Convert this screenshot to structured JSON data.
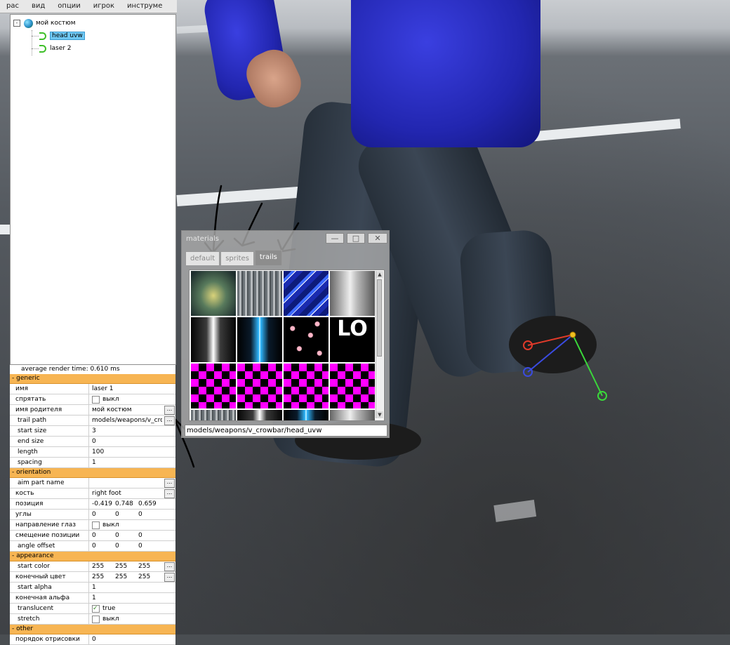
{
  "menu": [
    "рас",
    "вид",
    "опции",
    "игрок",
    "инструме"
  ],
  "tree": {
    "root": "мой костюм",
    "expander": "-",
    "children": [
      "head uvw",
      "laser 2"
    ]
  },
  "render_time": "average render time: 0.610 ms",
  "properties": {
    "generic": {
      "header": "-  generic",
      "name_key": "имя",
      "name_val": "laser 1",
      "hide_key": "спрятать",
      "hide_val": "выкл",
      "parent_key": "имя родителя",
      "parent_val": "мой костюм",
      "trail_key": "trail path",
      "trail_val": "models/weapons/v_crowbar/head_uvw",
      "start_size_key": "start size",
      "start_size_val": "3",
      "end_size_key": "end size",
      "end_size_val": "0",
      "length_key": "length",
      "length_val": "100",
      "spacing_key": "spacing",
      "spacing_val": "1"
    },
    "orientation": {
      "header": "-  orientation",
      "aim_key": "aim part name",
      "aim_val": "",
      "bone_key": "кость",
      "bone_val": "right foot",
      "pos_key": "позиция",
      "pos_vals": [
        "-0.419",
        "0.748",
        "0.659"
      ],
      "angles_key": "углы",
      "angles_vals": [
        "0",
        "0",
        "0"
      ],
      "eye_key": "направление глаз",
      "eye_val": "выкл",
      "pos_offset_key": "смещение позиции",
      "pos_offset_vals": [
        "0",
        "0",
        "0"
      ],
      "angle_offset_key": "angle offset",
      "angle_offset_vals": [
        "0",
        "0",
        "0"
      ]
    },
    "appearance": {
      "header": "-  appearance",
      "start_color_key": "start color",
      "start_color_vals": [
        "255",
        "255",
        "255"
      ],
      "end_color_key": "конечный цвет",
      "end_color_vals": [
        "255",
        "255",
        "255"
      ],
      "start_alpha_key": "start alpha",
      "start_alpha_val": "1",
      "end_alpha_key": "конечная альфа",
      "end_alpha_val": "1",
      "translucent_key": "translucent",
      "translucent_val": "true",
      "stretch_key": "stretch",
      "stretch_val": "выкл"
    },
    "other": {
      "header": "-  other",
      "draw_order_key": "порядок отрисовки",
      "draw_order_val": "0"
    }
  },
  "materials_window": {
    "title": "materials",
    "btn_min": "—",
    "btn_max": "□",
    "btn_close": "✕",
    "tabs": [
      "default",
      "sprites",
      "trails"
    ],
    "active_tab": "trails",
    "tile_text": "LO",
    "path": "models/weapons/v_crowbar/head_uvw"
  },
  "ellipsis": "...",
  "colors": {
    "section_header": "#f7b553",
    "selection": "#6fc8f3",
    "checkerboard_magenta": "#ff00ff"
  }
}
